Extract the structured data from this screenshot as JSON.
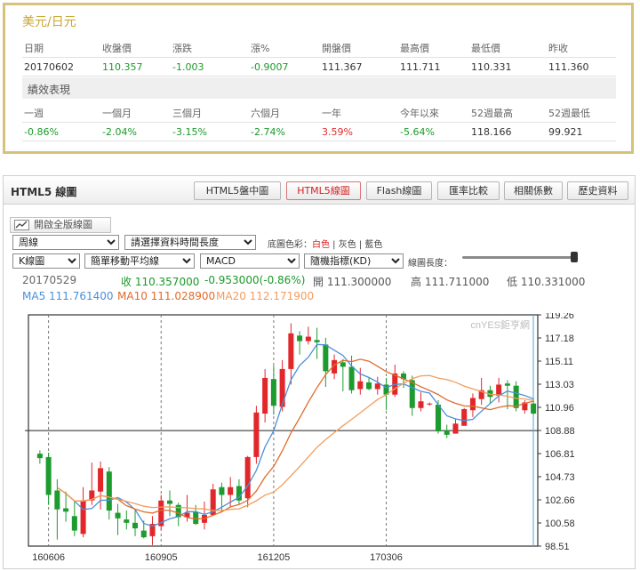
{
  "quote": {
    "title": "美元/日元",
    "headers": [
      "日期",
      "收盤價",
      "漲跌",
      "漲%",
      "開盤價",
      "最高價",
      "最低價",
      "昨收"
    ],
    "values": [
      "20170602",
      "110.357",
      "-1.003",
      "-0.9007",
      "111.367",
      "111.711",
      "110.331",
      "111.360"
    ],
    "perf_title": "績效表現",
    "perf_headers": [
      "一週",
      "一個月",
      "三個月",
      "六個月",
      "一年",
      "今年以來",
      "52週最高",
      "52週最低"
    ],
    "perf_values": [
      "-0.86%",
      "-2.04%",
      "-3.15%",
      "-2.74%",
      "3.59%",
      "-5.64%",
      "118.166",
      "99.921"
    ],
    "colors": {
      "gold": "#c9a531",
      "green": "#1a9a28",
      "red": "#e22b2b"
    }
  },
  "chart_panel": {
    "title": "HTML5 線圖",
    "tabs": [
      "HTML5盤中圖",
      "HTML5線圖",
      "Flash線圖",
      "匯率比較",
      "相關係數",
      "歷史資料"
    ],
    "active_tab": "HTML5線圖",
    "fullscreen_label": "開啟全版線圖",
    "period_select": "周線",
    "range_select": "請選擇資料時間長度",
    "bg_label_prefix": "底圖色彩：",
    "bg_white": "白色",
    "bg_gray": "灰色",
    "bg_blue": "藍色",
    "chart_type_select": "K線圖",
    "ma_select": "簡單移動平均線",
    "indicator_select": "MACD",
    "random_indicator_select": "隨機指標(KD)",
    "length_label": "線圖長度：",
    "length_value": 1.0,
    "info": {
      "date": "20170529",
      "close": "收 110.357000",
      "change": "-0.953000(-0.86%)",
      "open": "開 111.300000",
      "high": "高 111.711000",
      "low": "低 110.331000",
      "ma5": "MA5 111.761400",
      "ma10": "MA10 111.028900",
      "ma20": "MA20 112.171900"
    },
    "watermark": "cnYES鉅亨網"
  },
  "chart_data": {
    "type": "candlestick",
    "y_ticks": [
      "119.26",
      "117.18",
      "115.11",
      "113.03",
      "110.96",
      "108.88",
      "106.81",
      "104.73",
      "102.66",
      "100.58",
      "98.51"
    ],
    "ylim": [
      98.51,
      119.26
    ],
    "x_ticks": [
      "160606",
      "160905",
      "161205",
      "170306"
    ],
    "x_tick_index": [
      1,
      14,
      27,
      40
    ],
    "crosshair_price": 108.88,
    "candles": [
      [
        106.8,
        106.4,
        107.1,
        105.9
      ],
      [
        106.5,
        103.1,
        106.9,
        102.2
      ],
      [
        103.5,
        101.8,
        104.5,
        99.1
      ],
      [
        101.9,
        101.6,
        103.4,
        100.7
      ],
      [
        101.2,
        99.9,
        102.5,
        99.4
      ],
      [
        99.6,
        102.6,
        103.8,
        99.3
      ],
      [
        102.6,
        103.5,
        106.0,
        102.2
      ],
      [
        103.4,
        105.5,
        106.1,
        101.8
      ],
      [
        105.2,
        101.7,
        105.6,
        100.9
      ],
      [
        101.5,
        101.0,
        102.3,
        99.5
      ],
      [
        100.9,
        100.6,
        101.7,
        100.0
      ],
      [
        100.6,
        100.1,
        101.7,
        99.4
      ],
      [
        99.9,
        99.3,
        100.8,
        99.2
      ],
      [
        99.4,
        100.5,
        101.2,
        98.6
      ],
      [
        100.3,
        102.6,
        103.1,
        100.0
      ],
      [
        102.6,
        102.3,
        103.5,
        101.2
      ],
      [
        102.2,
        101.1,
        102.4,
        100.3
      ],
      [
        101.1,
        101.5,
        103.1,
        100.7
      ],
      [
        101.6,
        100.5,
        102.2,
        100.4
      ],
      [
        100.6,
        101.3,
        102.5,
        100.0
      ],
      [
        101.3,
        103.6,
        104.1,
        101.2
      ],
      [
        103.8,
        103.1,
        104.2,
        101.6
      ],
      [
        103.1,
        103.8,
        104.7,
        102.0
      ],
      [
        103.9,
        102.6,
        104.5,
        102.3
      ],
      [
        102.8,
        106.5,
        106.6,
        102.0
      ],
      [
        106.5,
        110.5,
        111.1,
        105.9
      ],
      [
        110.4,
        113.6,
        114.4,
        109.6
      ],
      [
        113.5,
        111.1,
        114.7,
        110.3
      ],
      [
        111.0,
        114.4,
        115.2,
        110.6
      ],
      [
        114.4,
        117.6,
        118.5,
        113.0
      ],
      [
        117.4,
        116.9,
        117.8,
        115.7
      ],
      [
        116.9,
        117.3,
        118.2,
        116.6
      ],
      [
        117.0,
        116.8,
        118.1,
        115.3
      ],
      [
        116.6,
        114.2,
        117.2,
        112.8
      ],
      [
        114.0,
        115.2,
        115.7,
        113.5
      ],
      [
        115.0,
        114.6,
        115.3,
        112.4
      ],
      [
        114.6,
        112.5,
        115.6,
        112.2
      ],
      [
        112.6,
        113.3,
        114.5,
        112.1
      ],
      [
        113.2,
        112.6,
        113.6,
        112.5
      ],
      [
        112.6,
        113.1,
        113.7,
        112.1
      ],
      [
        113.0,
        112.1,
        113.6,
        110.7
      ],
      [
        112.1,
        114.0,
        114.8,
        111.9
      ],
      [
        114.0,
        113.5,
        114.2,
        112.7
      ],
      [
        113.4,
        110.9,
        113.8,
        110.2
      ],
      [
        110.9,
        111.5,
        112.3,
        110.6
      ],
      [
        111.3,
        111.3,
        111.4,
        111.1
      ],
      [
        111.2,
        108.8,
        111.6,
        108.6
      ],
      [
        108.9,
        108.5,
        109.4,
        108.2
      ],
      [
        108.6,
        109.5,
        109.9,
        108.6
      ],
      [
        109.3,
        110.8,
        110.9,
        109.6
      ],
      [
        110.7,
        111.8,
        112.2,
        110.1
      ],
      [
        111.7,
        112.5,
        113.6,
        111.2
      ],
      [
        112.5,
        111.9,
        112.9,
        111.3
      ],
      [
        112.0,
        113.0,
        113.6,
        111.4
      ],
      [
        113.1,
        112.9,
        113.4,
        110.8
      ],
      [
        112.9,
        110.9,
        113.3,
        110.6
      ],
      [
        110.7,
        111.4,
        111.6,
        110.4
      ],
      [
        111.3,
        110.4,
        111.7,
        110.3
      ]
    ],
    "series": [
      {
        "name": "MA5",
        "color": "#4a90d9"
      },
      {
        "name": "MA10",
        "color": "#e06b2c"
      },
      {
        "name": "MA20",
        "color": "#f39c5c"
      }
    ]
  }
}
